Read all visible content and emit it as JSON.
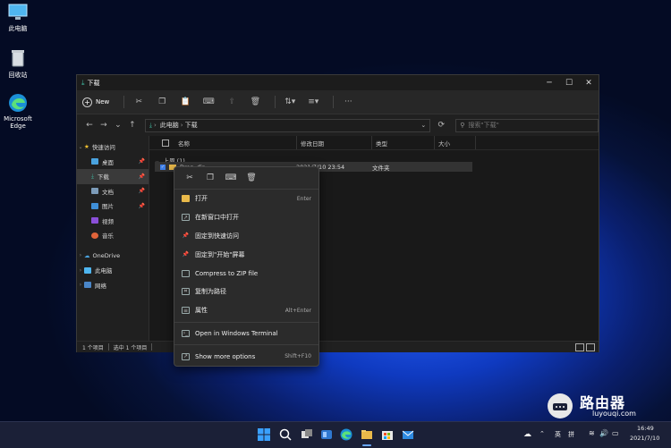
{
  "desktop": {
    "icons": [
      {
        "label": "此电脑"
      },
      {
        "label": "回收站"
      },
      {
        "label": "Microsoft Edge"
      }
    ]
  },
  "window": {
    "title": "下载",
    "controls": {
      "minimize": "─",
      "maximize": "☐",
      "close": "✕"
    },
    "command_bar": {
      "new_label": "New"
    },
    "address": {
      "crumbs": [
        "此电脑",
        "下载"
      ]
    },
    "search": {
      "placeholder": "搜索\"下载\""
    },
    "sidebar": {
      "items": [
        {
          "label": "快速访问"
        },
        {
          "label": "桌面"
        },
        {
          "label": "下载"
        },
        {
          "label": "文档"
        },
        {
          "label": "图片"
        },
        {
          "label": "视频"
        },
        {
          "label": "音乐"
        },
        {
          "label": "OneDrive"
        },
        {
          "label": "此电脑"
        },
        {
          "label": "网络"
        }
      ]
    },
    "columns": {
      "name": "名称",
      "modified": "修改日期",
      "type": "类型",
      "size": "大小"
    },
    "group_label": "上周 (1)",
    "file_row": {
      "name": "Drop_dir",
      "modified": "2021/7/10 23:54",
      "type": "文件夹"
    },
    "status": {
      "count": "1 个项目",
      "selected": "选中 1 个项目"
    }
  },
  "context_menu": {
    "items": [
      {
        "label": "打开",
        "shortcut": "Enter"
      },
      {
        "label": "在新窗口中打开",
        "shortcut": ""
      },
      {
        "label": "固定到快速访问",
        "shortcut": ""
      },
      {
        "label": "固定到\"开始\"屏幕",
        "shortcut": ""
      },
      {
        "label": "Compress to ZIP file",
        "shortcut": ""
      },
      {
        "label": "复制为路径",
        "shortcut": ""
      },
      {
        "label": "属性",
        "shortcut": "Alt+Enter"
      },
      {
        "label": "Open in Windows Terminal",
        "shortcut": ""
      },
      {
        "label": "Show more options",
        "shortcut": "Shift+F10"
      }
    ]
  },
  "taskbar": {
    "tray": {
      "ime1": "英",
      "ime2": "拼",
      "time": "16:49",
      "date": "2021/7/10"
    }
  },
  "watermark": {
    "brand": "路由器",
    "url": "luyouqi.com"
  },
  "colors": {
    "accent": "#3d7ee8",
    "folder": "#e9b94a"
  }
}
